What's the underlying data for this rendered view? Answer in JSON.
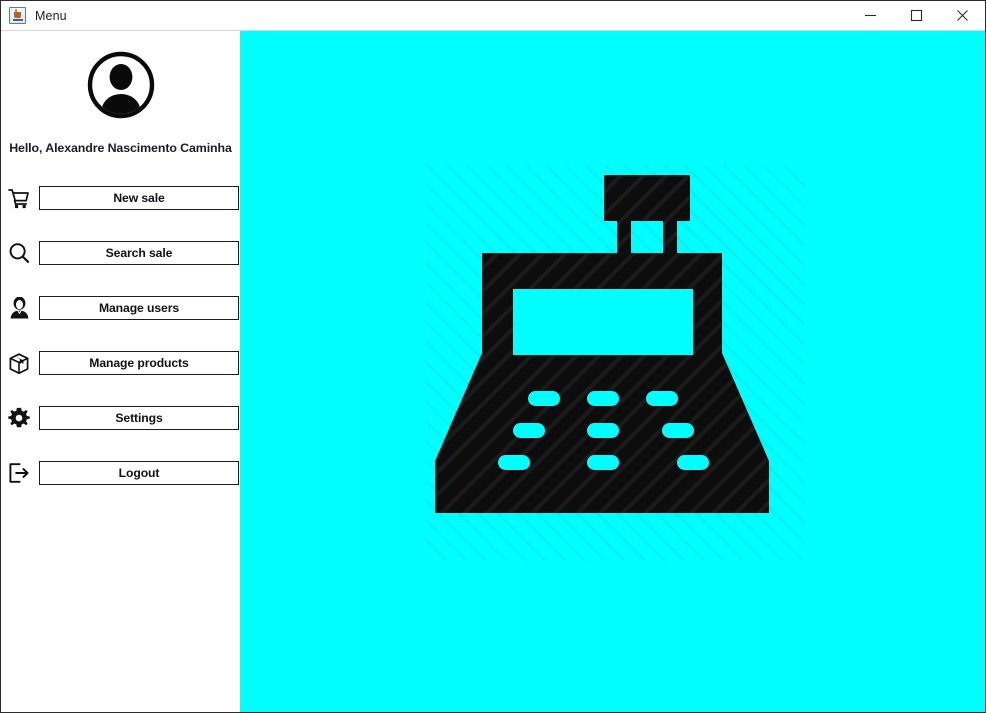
{
  "window": {
    "title": "Menu",
    "app_icon": "java-coffee-cup-icon",
    "controls": [
      {
        "name": "minimize",
        "glyph": "—"
      },
      {
        "name": "maximize",
        "glyph": "□"
      },
      {
        "name": "close",
        "glyph": "✕"
      }
    ]
  },
  "sidebar": {
    "avatar_icon": "user-avatar-icon",
    "greeting": "Hello, Alexandre Nascimento Caminha",
    "items": [
      {
        "label": "New sale",
        "icon": "shopping-cart-icon"
      },
      {
        "label": "Search sale",
        "icon": "magnifier-icon"
      },
      {
        "label": "Manage users",
        "icon": "user-person-icon"
      },
      {
        "label": "Manage products",
        "icon": "box-package-icon"
      },
      {
        "label": "Settings",
        "icon": "gear-icon"
      },
      {
        "label": "Logout",
        "icon": "exit-arrow-icon"
      }
    ]
  },
  "main": {
    "illustration": "cash-register-icon",
    "background_color": "#00FFFF",
    "illustration_color": "#0d0d0d"
  }
}
